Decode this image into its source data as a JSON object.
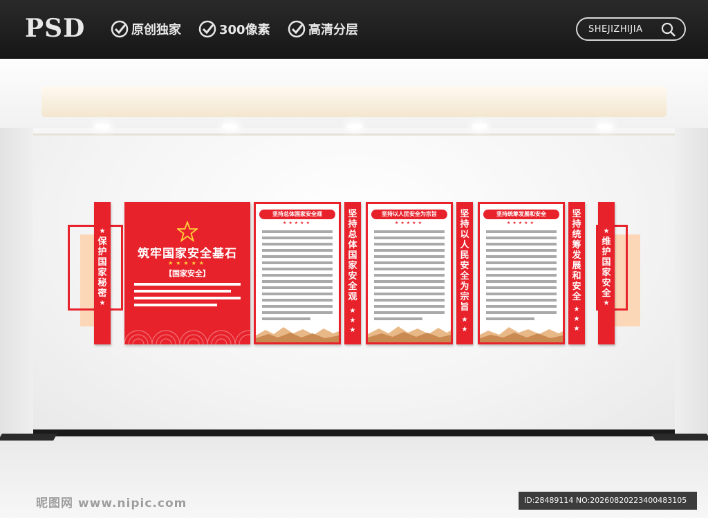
{
  "banner": {
    "logo": "PSD",
    "features": [
      "原创独家",
      "300像素",
      "高清分层"
    ],
    "search_text": "SHEJIZHIJIA"
  },
  "display": {
    "left_bar": "保护国家秘密",
    "main_title": "筑牢国家安全基石",
    "main_stars": "★★★★★",
    "main_subtitle": "【国家安全】",
    "panels": [
      {
        "heading": "坚持总体国家安全观",
        "stars": "★★★★★"
      },
      {
        "heading": "坚持以人民安全为宗旨",
        "stars": "★★★★★"
      },
      {
        "heading": "坚持统筹发展和安全",
        "stars": "★★★★★"
      }
    ],
    "divider_bars": [
      "坚持总体国家安全观",
      "坚持以人民安全为宗旨",
      "坚持统筹发展和安全"
    ],
    "right_bar": "维护国家安全",
    "star_glyph": "★"
  },
  "watermark": {
    "site": "昵图网 www.nipic.com",
    "id_text": "ID:28489114 NO:20260820223400483105"
  },
  "colors": {
    "red": "#e8222b",
    "peach": "#fbd7b8",
    "grey_text_line": "#a9a9a9"
  }
}
